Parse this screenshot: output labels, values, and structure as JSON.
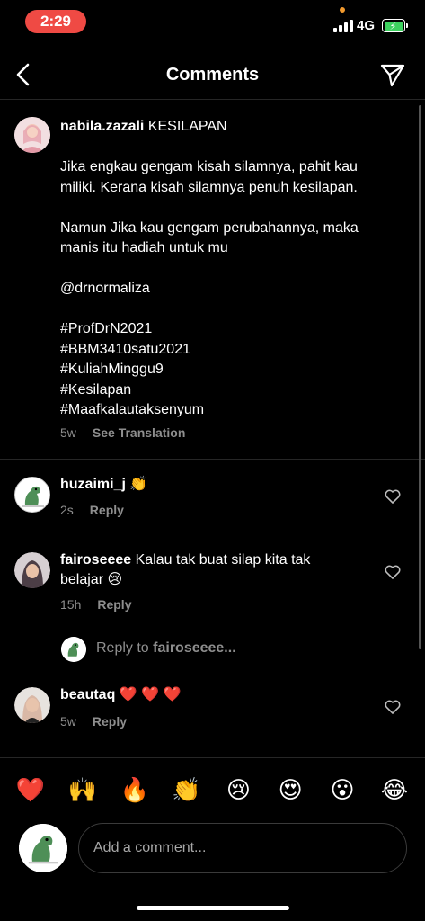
{
  "status_bar": {
    "time": "2:29",
    "network": "4G"
  },
  "header": {
    "title": "Comments",
    "back_icon": "chevron-left-icon",
    "share_icon": "paper-plane-icon"
  },
  "caption": {
    "username": "nabila.zazali",
    "first_line": "KESILAPAN",
    "lines": [
      "Jika engkau gengam kisah silamnya, pahit kau",
      "miliki. Kerana kisah silamnya penuh kesilapan.",
      "",
      "Namun Jika kau gengam perubahannya, maka",
      "manis itu hadiah untuk mu",
      "",
      "@drnormaliza",
      "",
      "#ProfDrN2021",
      "#BBM3410satu2021",
      "#KuliahMinggu9",
      "#Kesilapan",
      "#Maafkalautaksenyum"
    ],
    "time": "5w",
    "see_translation": "See Translation"
  },
  "comments": [
    {
      "username": "huzaimi_j",
      "text": "👏",
      "time": "2s",
      "reply_label": "Reply"
    },
    {
      "username": "fairoseeee",
      "text_line1": "Kalau tak buat silap kita tak",
      "text_line2": "belajar 😢",
      "time": "15h",
      "reply_label": "Reply"
    },
    {
      "username": "beautaq",
      "text": "❤️ ❤️ ❤️",
      "time": "5w",
      "reply_label": "Reply"
    }
  ],
  "reply_prompt": {
    "prefix": "Reply to ",
    "username": "fairoseeee..."
  },
  "emoji_bar": [
    "❤️",
    "🙌",
    "🔥",
    "👏",
    "😢",
    "😍",
    "😮",
    "😂"
  ],
  "input": {
    "placeholder": "Add a comment..."
  },
  "colors": {
    "background": "#000000",
    "secondary_text": "#8e8e8e",
    "time_pill": "#ef4a44",
    "battery": "#3dd15f"
  }
}
